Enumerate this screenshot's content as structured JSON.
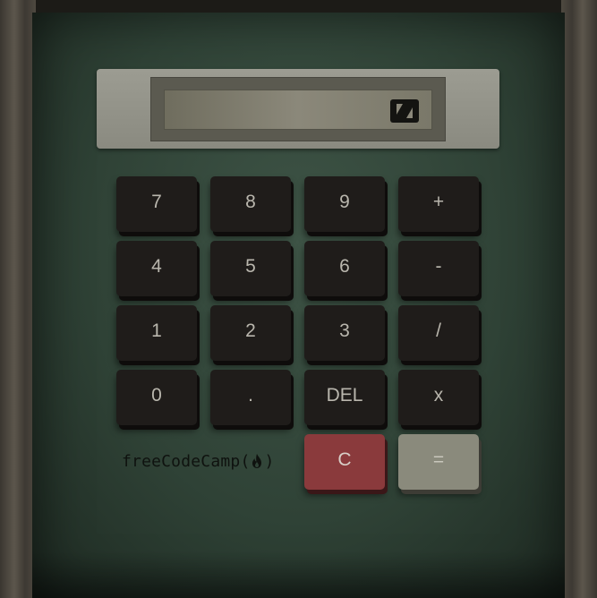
{
  "display": {
    "value": "",
    "icon": "freecodecamp-logo-icon"
  },
  "keys": [
    {
      "label": "7"
    },
    {
      "label": "8"
    },
    {
      "label": "9"
    },
    {
      "label": "+"
    },
    {
      "label": "4"
    },
    {
      "label": "5"
    },
    {
      "label": "6"
    },
    {
      "label": "-"
    },
    {
      "label": "1"
    },
    {
      "label": "2"
    },
    {
      "label": "3"
    },
    {
      "label": "/"
    },
    {
      "label": "0"
    },
    {
      "label": "."
    },
    {
      "label": "DEL"
    },
    {
      "label": "x"
    }
  ],
  "clear_label": "C",
  "equals_label": "=",
  "brand": {
    "prefix": "freeCodeCamp(",
    "suffix": ")",
    "icon": "flame-icon"
  },
  "colors": {
    "clear": "#8a3a3c",
    "equals": "#8a8a7c",
    "key": "#1f1c1a",
    "body": "#2f4236"
  }
}
